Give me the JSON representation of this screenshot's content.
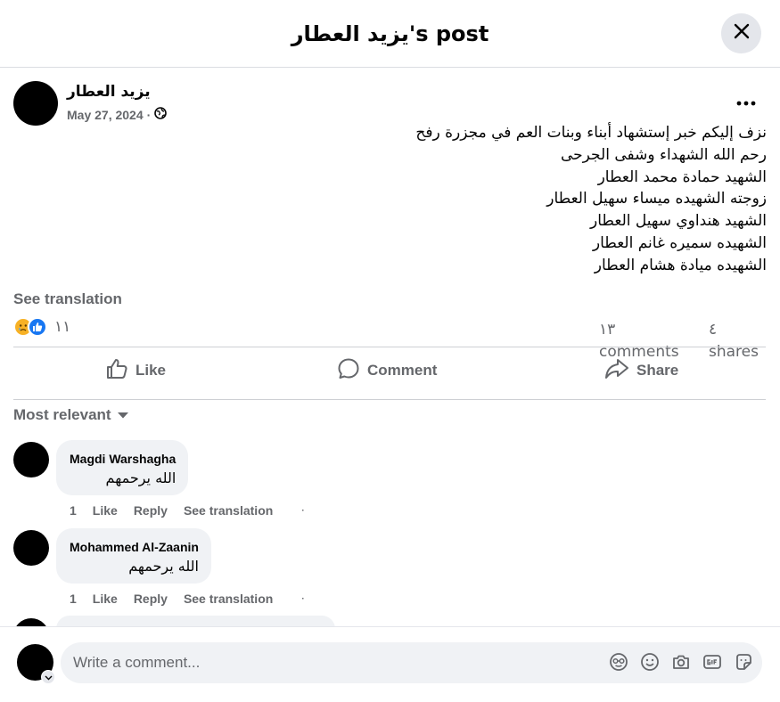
{
  "header": {
    "title": "يزيد العطار's post"
  },
  "post": {
    "author": "يزيد العطار",
    "date": "May 27, 2024",
    "date_separator": "·",
    "lines": [
      "نزف إليكم خبر إستشهاد أبناء وبنات العم في مجزرة رفح",
      "رحم الله الشهداء وشفى الجرحى",
      "الشهيد حمادة محمد العطار",
      "زوجته الشهيده ميساء سهيل العطار",
      "الشهيد هنداوي سهيل العطار",
      "الشهيده سميره غانم العطار",
      "الشهيده ميادة هشام العطار"
    ],
    "see_translation": "See translation",
    "reaction_count": "١١",
    "comments_count": "١٣",
    "comments_label": "comments",
    "shares_count": "٤",
    "shares_label": "shares"
  },
  "actions": {
    "like": "Like",
    "comment": "Comment",
    "share": "Share"
  },
  "sort": {
    "label": "Most relevant"
  },
  "comments": [
    {
      "name": "Magdi Warshagha",
      "text": "الله يرحمهم",
      "time": "1",
      "like": "Like",
      "reply": "Reply",
      "translate": "See translation",
      "dot": "·"
    },
    {
      "name": "Mohammed Al-Zaanin",
      "text": "الله يرحمهم",
      "time": "1",
      "like": "Like",
      "reply": "Reply",
      "translate": "See translation",
      "dot": "·"
    }
  ],
  "composer": {
    "placeholder": "Write a comment..."
  },
  "icons": {
    "close": "close-icon",
    "globe": "globe-icon",
    "more": "more-icon",
    "like": "thumbs-up-icon",
    "comment": "comment-icon",
    "share": "share-icon",
    "sort": "caret-down-icon",
    "avatar_icon": "sticker-avatar-icon",
    "emoji": "emoji-icon",
    "camera": "camera-icon",
    "gif": "gif-icon",
    "sticker": "sticker-icon"
  },
  "colors": {
    "accent": "#1877f2",
    "muted": "#65676b",
    "bubble": "#f0f2f5",
    "sad": "#f7b125"
  }
}
